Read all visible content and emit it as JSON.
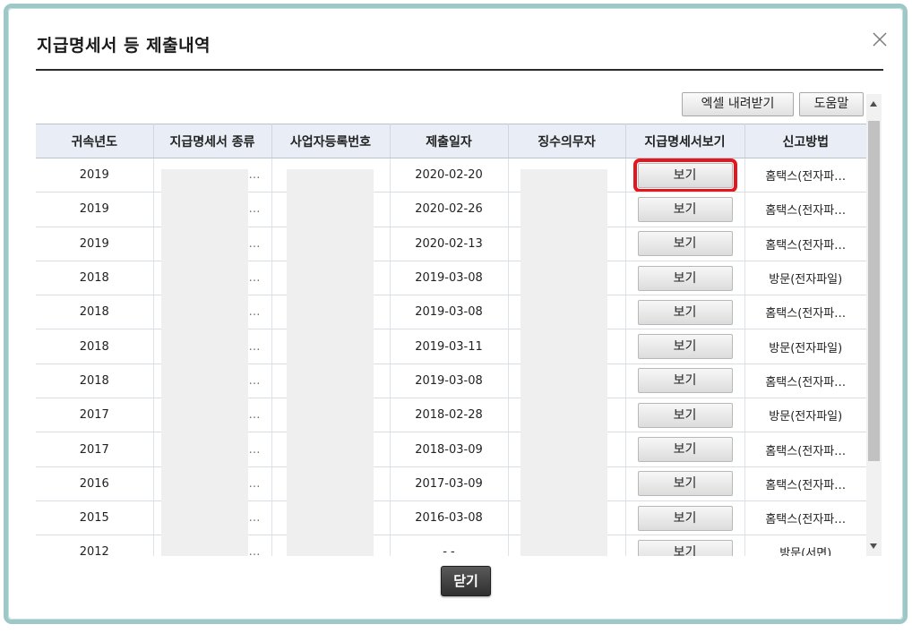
{
  "dialog": {
    "title": "지급명세서 등 제출내역",
    "toolbar": {
      "excel_label": "엑셀 내려받기",
      "help_label": "도움말"
    },
    "close_label": "닫기"
  },
  "table": {
    "columns": [
      "귀속년도",
      "지급명세서 종류",
      "사업자등록번호",
      "제출일자",
      "징수의무자",
      "지급명세서보기",
      "신고방법"
    ],
    "view_label": "보기",
    "rows": [
      {
        "year": "2019",
        "kind": "…",
        "date": "2020-02-20",
        "method": "홈택스(전자파…"
      },
      {
        "year": "2019",
        "kind": "…",
        "date": "2020-02-26",
        "method": "홈택스(전자파…"
      },
      {
        "year": "2019",
        "kind": "…",
        "date": "2020-02-13",
        "method": "홈택스(전자파…"
      },
      {
        "year": "2018",
        "kind": "…",
        "date": "2019-03-08",
        "method": "방문(전자파일)"
      },
      {
        "year": "2018",
        "kind": "…",
        "date": "2019-03-08",
        "method": "홈택스(전자파…"
      },
      {
        "year": "2018",
        "kind": "…",
        "date": "2019-03-11",
        "method": "방문(전자파일)"
      },
      {
        "year": "2018",
        "kind": "…",
        "date": "2019-03-08",
        "method": "홈택스(전자파…"
      },
      {
        "year": "2017",
        "kind": "…",
        "date": "2018-02-28",
        "method": "방문(전자파일)"
      },
      {
        "year": "2017",
        "kind": "…",
        "date": "2018-03-09",
        "method": "홈택스(전자파…"
      },
      {
        "year": "2016",
        "kind": "…",
        "date": "2017-03-09",
        "method": "홈택스(전자파…"
      },
      {
        "year": "2015",
        "kind": "…",
        "date": "2016-03-08",
        "method": "홈택스(전자파…"
      },
      {
        "year": "2012",
        "kind": "…",
        "date": "- -",
        "method": "방문(서면)"
      }
    ]
  },
  "colors": {
    "highlight": "#e3171d",
    "border": "#9ec8c8",
    "header_bg": "#e9eef6"
  },
  "icons": {
    "close": "close-icon",
    "scroll_up": "chevron-up-icon",
    "scroll_down": "chevron-down-icon"
  }
}
